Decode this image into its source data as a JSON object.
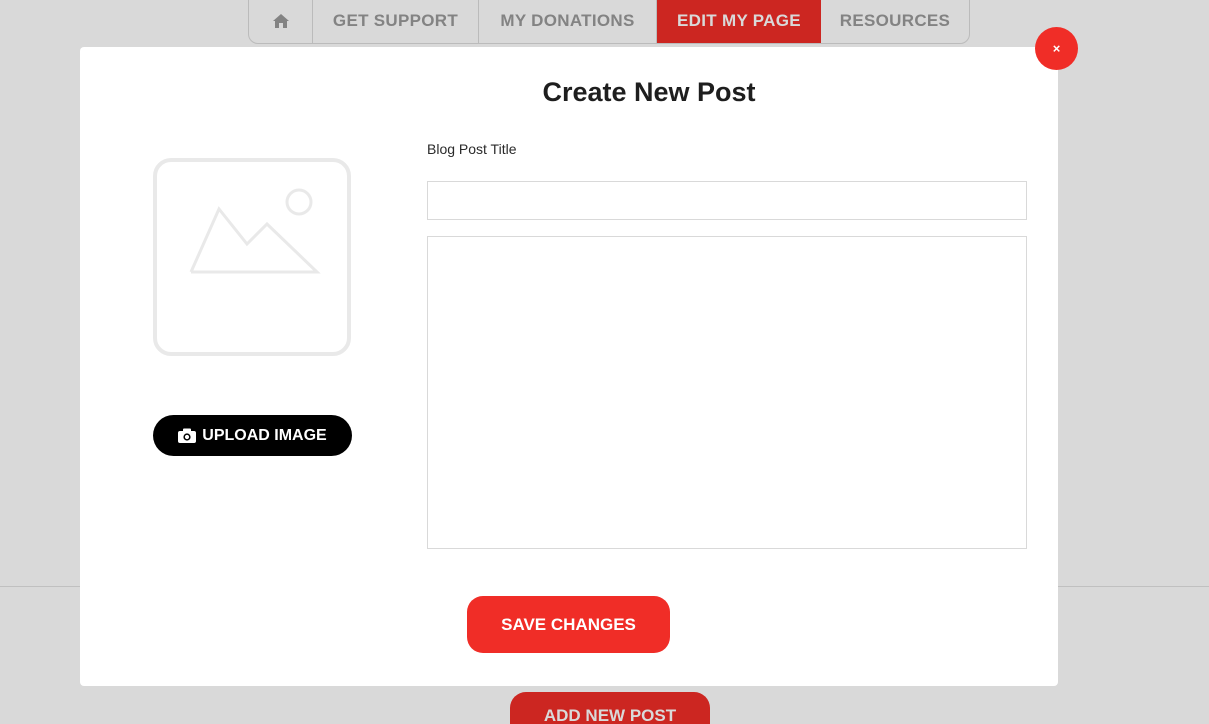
{
  "nav": {
    "home_icon": "home-icon",
    "items": [
      {
        "label": "GET SUPPORT"
      },
      {
        "label": "MY DONATIONS"
      },
      {
        "label": "EDIT MY PAGE",
        "active": true
      },
      {
        "label": "RESOURCES"
      }
    ]
  },
  "background": {
    "add_post_label": "ADD NEW POST"
  },
  "modal": {
    "title": "Create New Post",
    "image_icon": "image-placeholder-icon",
    "upload_icon": "camera-icon",
    "upload_label": "UPLOAD IMAGE",
    "title_field_label": "Blog Post Title",
    "title_value": "",
    "title_placeholder": "",
    "body_value": "",
    "body_placeholder": "",
    "save_label": "SAVE CHANGES",
    "close_label": "×"
  },
  "colors": {
    "accent": "#f02d27",
    "dark": "#000000",
    "placeholder_stroke": "#e9e9e9"
  }
}
